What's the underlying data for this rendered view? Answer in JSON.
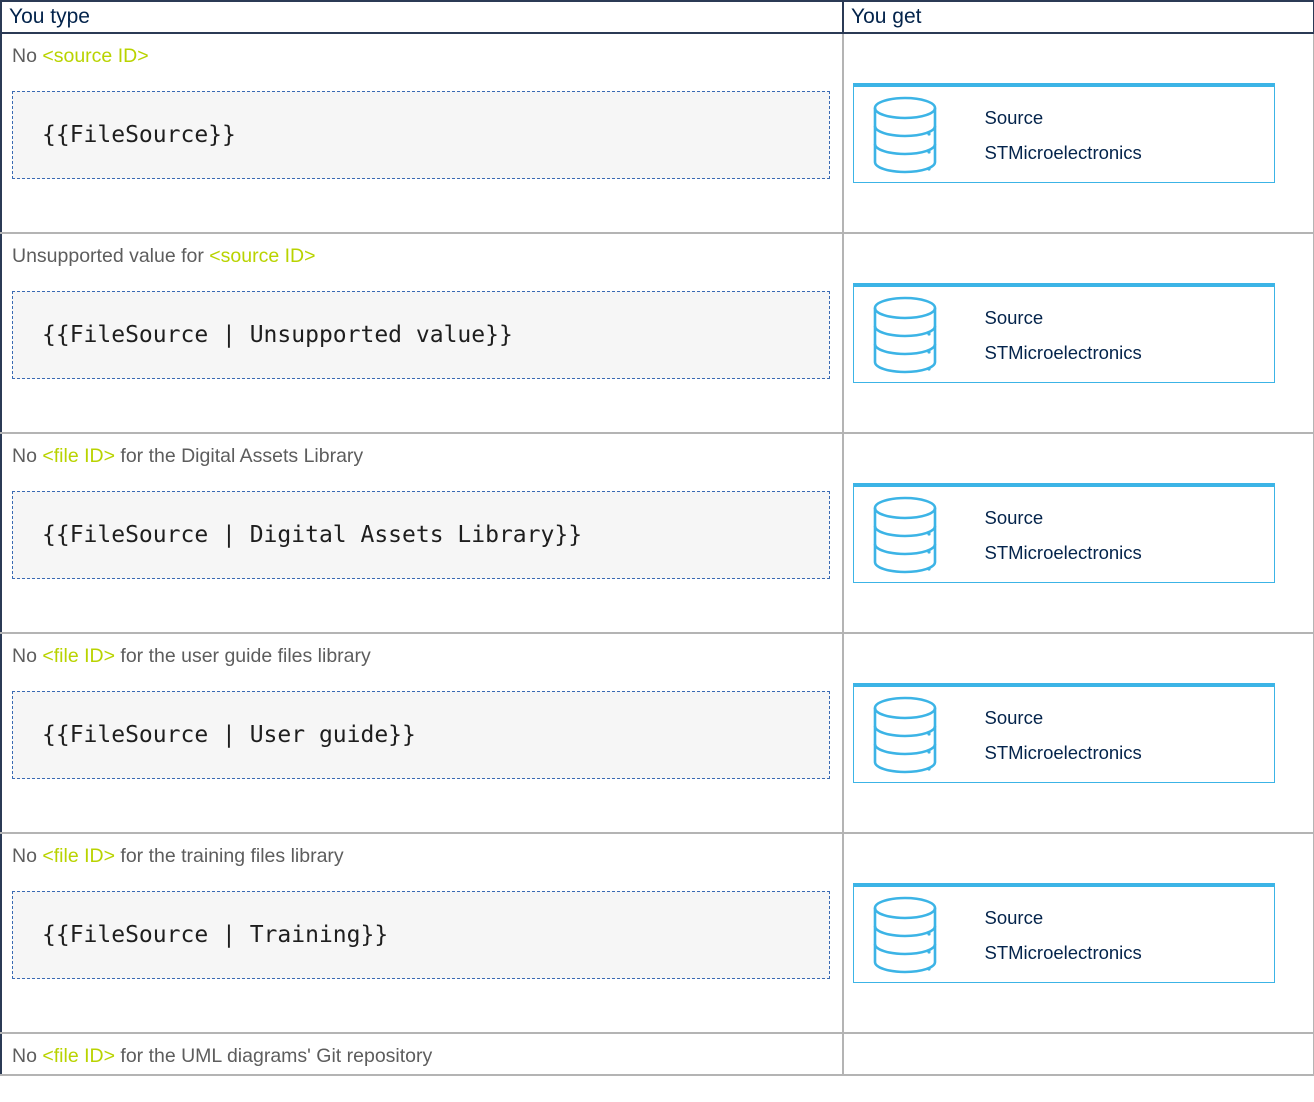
{
  "table": {
    "headers": [
      "You type",
      "You get"
    ],
    "rows": [
      {
        "desc_before": "No ",
        "desc_param": "<source ID>",
        "desc_after": "",
        "code": "{{FileSource}}",
        "result_line1": "Source",
        "result_line2": "STMicroelectronics"
      },
      {
        "desc_before": "Unsupported value for ",
        "desc_param": "<source ID>",
        "desc_after": "",
        "code": "{{FileSource | Unsupported value}}",
        "result_line1": "Source",
        "result_line2": "STMicroelectronics"
      },
      {
        "desc_before": "No ",
        "desc_param": "<file ID>",
        "desc_after": " for the Digital Assets Library",
        "code": "{{FileSource | Digital Assets Library}}",
        "result_line1": "Source",
        "result_line2": "STMicroelectronics"
      },
      {
        "desc_before": "No ",
        "desc_param": "<file ID>",
        "desc_after": " for the user guide files library",
        "code": "{{FileSource | User guide}}",
        "result_line1": "Source",
        "result_line2": "STMicroelectronics"
      },
      {
        "desc_before": "No ",
        "desc_param": "<file ID>",
        "desc_after": " for the training files library",
        "code": "{{FileSource | Training}}",
        "result_line1": "Source",
        "result_line2": "STMicroelectronics"
      }
    ],
    "last_row": {
      "desc_before": "No ",
      "desc_param": "<file ID>",
      "desc_after": " for the UML diagrams' Git repository"
    }
  },
  "icon": "database-icon",
  "colors": {
    "header_text": "#03234b",
    "param_highlight": "#b9d300",
    "result_border": "#3cb4e6",
    "code_border": "#3a6ab3"
  }
}
